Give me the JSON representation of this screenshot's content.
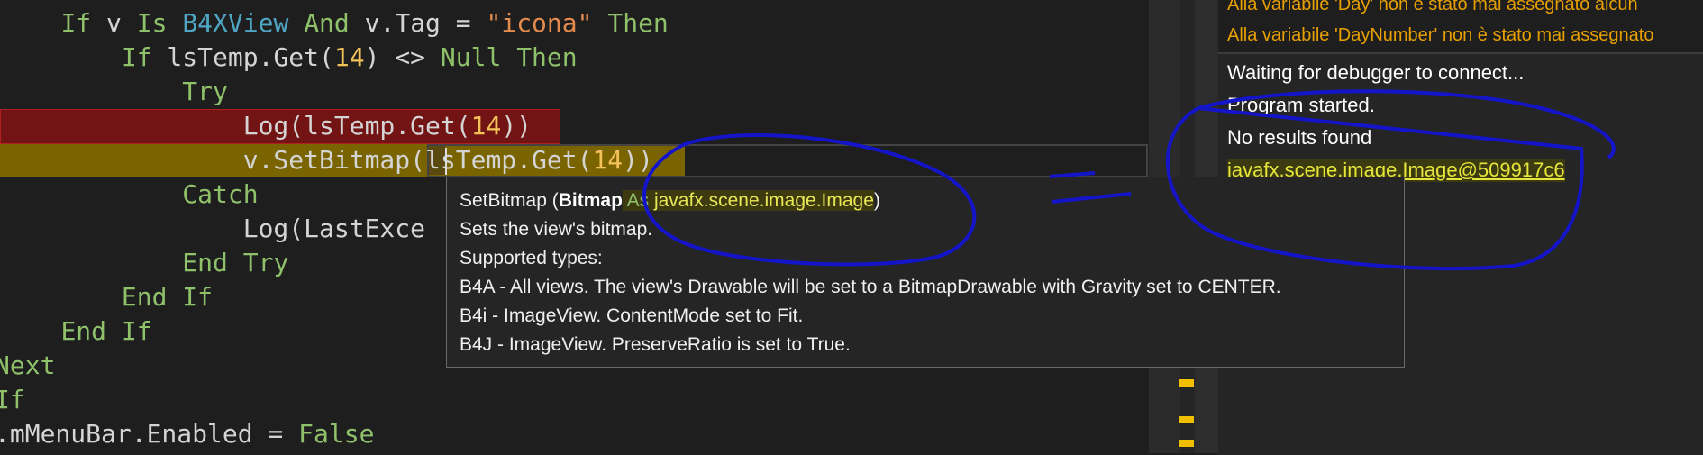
{
  "code_lines": [
    {
      "indent": "    ",
      "parts": [
        {
          "c": "kw",
          "t": "If"
        },
        {
          "c": "",
          "t": " v "
        },
        {
          "c": "kw",
          "t": "Is"
        },
        {
          "c": "",
          "t": " "
        },
        {
          "c": "tp",
          "t": "B4XView"
        },
        {
          "c": "",
          "t": " "
        },
        {
          "c": "kw",
          "t": "And"
        },
        {
          "c": "",
          "t": " v.Tag = "
        },
        {
          "c": "st",
          "t": "\"icona\""
        },
        {
          "c": "",
          "t": " "
        },
        {
          "c": "kw",
          "t": "Then"
        }
      ]
    },
    {
      "indent": "        ",
      "parts": [
        {
          "c": "kw",
          "t": "If"
        },
        {
          "c": "",
          "t": " lsTemp.Get("
        },
        {
          "c": "nm",
          "t": "14"
        },
        {
          "c": "",
          "t": ") <> "
        },
        {
          "c": "kw",
          "t": "Null"
        },
        {
          "c": "",
          "t": " "
        },
        {
          "c": "kw",
          "t": "Then"
        }
      ]
    },
    {
      "indent": "            ",
      "parts": [
        {
          "c": "kw",
          "t": "Try"
        }
      ]
    },
    {
      "indent": "                ",
      "parts": [
        {
          "c": "",
          "t": "Log(lsTemp.Get("
        },
        {
          "c": "nm",
          "t": "14"
        },
        {
          "c": "",
          "t": "))"
        }
      ]
    },
    {
      "indent": "                ",
      "parts": [
        {
          "c": "",
          "t": "v.SetBitmap(lsTemp.Get("
        },
        {
          "c": "nm",
          "t": "14"
        },
        {
          "c": "",
          "t": "))"
        }
      ]
    },
    {
      "indent": "            ",
      "parts": [
        {
          "c": "kw",
          "t": "Catch"
        }
      ]
    },
    {
      "indent": "                ",
      "parts": [
        {
          "c": "",
          "t": "Log(LastExce"
        }
      ]
    },
    {
      "indent": "            ",
      "parts": [
        {
          "c": "kw",
          "t": "End Try"
        }
      ]
    },
    {
      "indent": "        ",
      "parts": [
        {
          "c": "kw",
          "t": "End If"
        }
      ]
    },
    {
      "indent": "    ",
      "parts": [
        {
          "c": "kw",
          "t": "End If"
        }
      ]
    },
    {
      "indent": "",
      "parts": [
        {
          "c": "kw",
          "t": "Next"
        }
      ]
    },
    {
      "indent": "",
      "parts": [
        {
          "c": "kw",
          "t": "If"
        }
      ]
    },
    {
      "indent": "",
      "parts": [
        {
          "c": "",
          "t": ".mMenuBar.Enabled = "
        },
        {
          "c": "kw",
          "t": "False"
        }
      ]
    }
  ],
  "warnings": [
    "Alla variabile 'Day' non è stato mai assegnato alcun",
    "Alla variabile 'DayNumber' non è stato mai assegnato"
  ],
  "logs": [
    "Waiting for debugger to connect...",
    "Program started.",
    "No results found",
    "javafx.scene.image.Image@509917c6"
  ],
  "tooltip": {
    "method": "SetBitmap",
    "open_paren": " (",
    "param": "Bitmap",
    "as_kw": " As ",
    "type": "javafx.scene.image.Image",
    "close_paren": ")",
    "description": "Sets the view's bitmap.",
    "supported": " Supported types:",
    "b4a": " B4A - All views. The view's Drawable will be set to a BitmapDrawable with Gravity set to CENTER.",
    "b4i": " B4i - ImageView. ContentMode set to Fit.",
    "b4j": " B4J - ImageView. PreserveRatio is set to True."
  },
  "colors": {
    "keyword": "#8fc06a",
    "type": "#4fa5c4",
    "string": "#e38b4c",
    "number": "#f3c35a",
    "annotation": "#1414c8",
    "warning": "#e8a000"
  }
}
